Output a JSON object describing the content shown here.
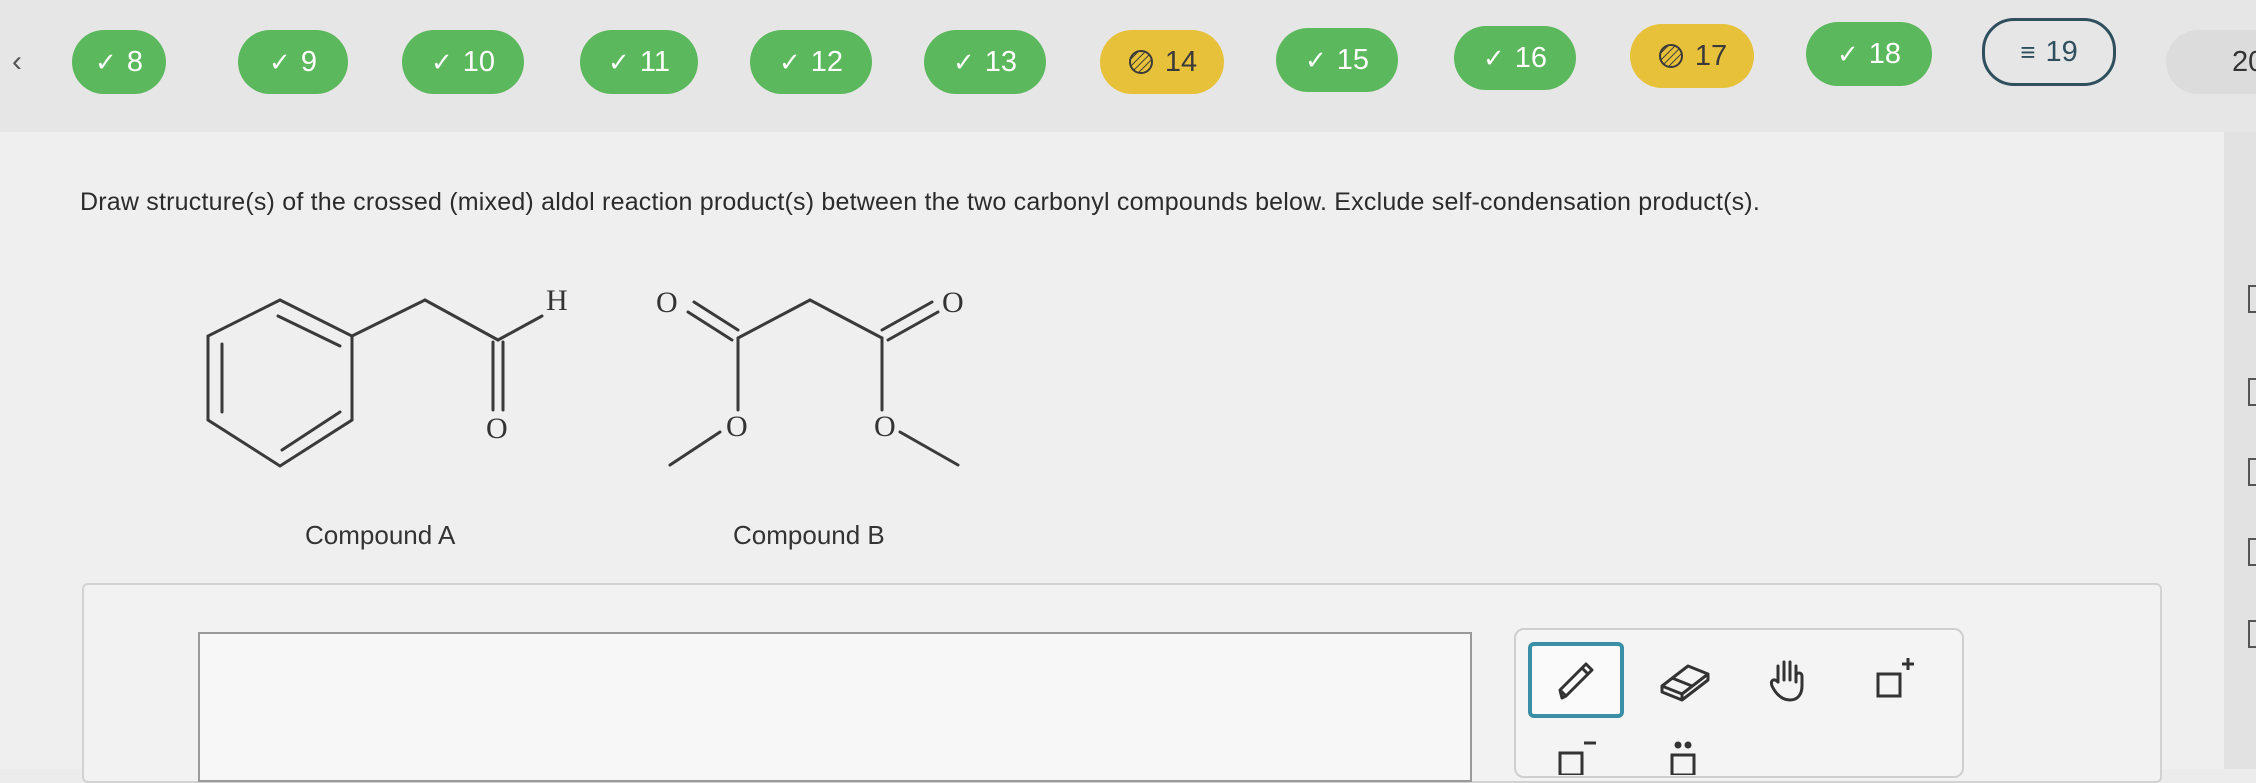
{
  "nav": {
    "questions": [
      {
        "num": "8",
        "status": "done"
      },
      {
        "num": "9",
        "status": "done"
      },
      {
        "num": "10",
        "status": "done"
      },
      {
        "num": "11",
        "status": "done"
      },
      {
        "num": "12",
        "status": "done"
      },
      {
        "num": "13",
        "status": "done"
      },
      {
        "num": "14",
        "status": "partial"
      },
      {
        "num": "15",
        "status": "done"
      },
      {
        "num": "16",
        "status": "done"
      },
      {
        "num": "17",
        "status": "partial"
      },
      {
        "num": "18",
        "status": "done"
      },
      {
        "num": "19",
        "status": "current"
      }
    ],
    "next_peek": "20",
    "check_glyph": "✓",
    "current_glyph": "≡",
    "back_glyph": "‹"
  },
  "question": {
    "text": "Draw structure(s) of the crossed (mixed) aldol reaction product(s) between the two carbonyl compounds below. Exclude self-condensation product(s)."
  },
  "compounds": {
    "a": {
      "label": "Compound A",
      "atoms": {
        "h": "H",
        "o": "O"
      }
    },
    "b": {
      "label": "Compound B",
      "atoms": {
        "o1": "O",
        "o2": "O",
        "o3": "O",
        "o4": "O"
      }
    }
  },
  "colors": {
    "done": "#5cb85c",
    "partial": "#e8c13a",
    "current_border": "#2f4f5f",
    "active_tool": "#3a8fa6"
  },
  "tools": [
    "pencil-icon",
    "eraser-icon",
    "hand-icon",
    "add-box-icon"
  ]
}
